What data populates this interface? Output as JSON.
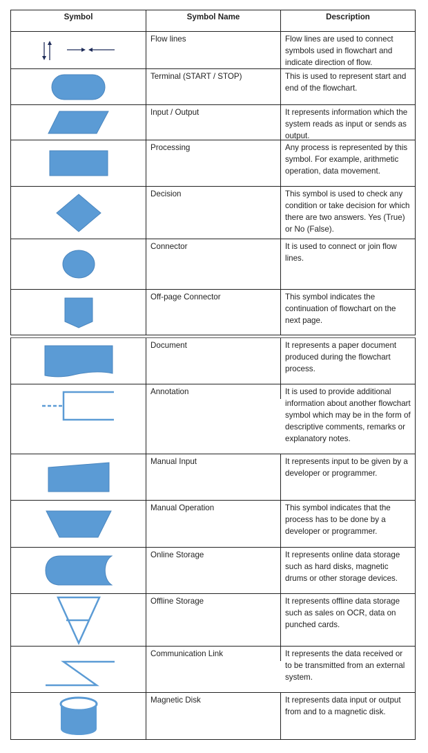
{
  "table": {
    "headers": {
      "symbol": "Symbol",
      "name": "Symbol Name",
      "description": "Description"
    },
    "shape_color": "#5b9bd5",
    "arrow_color": "#1f2d5a",
    "rows": [
      {
        "icon": "flow-lines-icon",
        "name": "Flow lines",
        "description": "Flow lines are used to connect symbols used in flowchart and indicate direction of flow."
      },
      {
        "icon": "terminal-icon",
        "name": "Terminal (START / STOP)",
        "description": "This is used to represent start and end of the flowchart."
      },
      {
        "icon": "input-output-icon",
        "name": "Input / Output",
        "description": "It represents information which the system reads as input or sends as output."
      },
      {
        "icon": "processing-icon",
        "name": "Processing",
        "description": "Any process is represented by this symbol. For example, arithmetic operation, data movement."
      },
      {
        "icon": "decision-icon",
        "name": "Decision",
        "description": "This symbol is used to check any condition or take decision for which there are two answers. Yes (True) or No (False)."
      },
      {
        "icon": "connector-icon",
        "name": "Connector",
        "description": "It is used to connect or join flow lines."
      },
      {
        "icon": "off-page-connector-icon",
        "name": "Off-page Connector",
        "description": "This symbol indicates the continuation of flowchart on the next page."
      },
      {
        "icon": "document-icon",
        "name": "Document",
        "description": "It represents a paper document produced during the flowchart process."
      },
      {
        "icon": "annotation-icon",
        "name": "Annotation",
        "description": "It is used to provide additional information about another flowchart symbol which may be in the form of descriptive comments, remarks or explanatory notes."
      },
      {
        "icon": "manual-input-icon",
        "name": "Manual Input",
        "description": "It represents input to be given by a developer or programmer."
      },
      {
        "icon": "manual-operation-icon",
        "name": "Manual Operation",
        "description": "This symbol indicates that the process has to be done by a developer or programmer."
      },
      {
        "icon": "online-storage-icon",
        "name": "Online Storage",
        "description": "It represents online data storage such as hard disks, magnetic drums or other storage devices."
      },
      {
        "icon": "offline-storage-icon",
        "name": "Offline Storage",
        "description": "It represents offline data storage such as sales on OCR, data on punched cards."
      },
      {
        "icon": "communication-link-icon",
        "name": "Communication Link",
        "description": "It represents the data received or to be transmitted from an external system."
      },
      {
        "icon": "magnetic-disk-icon",
        "name": "Magnetic Disk",
        "description": "It represents data input or output from and to a magnetic disk."
      }
    ]
  }
}
